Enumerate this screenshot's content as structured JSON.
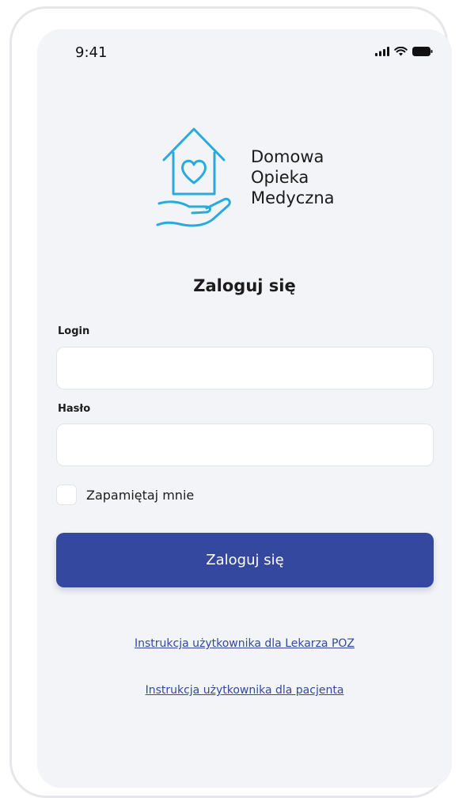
{
  "status_bar": {
    "time": "9:41",
    "icons": [
      "signal-icon",
      "wifi-icon",
      "battery-icon"
    ]
  },
  "logo": {
    "icon": "house-heart-hand-icon",
    "color": "#2aa9dc",
    "lines": [
      "Domowa",
      "Opieka",
      "Medyczna"
    ]
  },
  "form": {
    "title": "Zaloguj się",
    "login_label": "Login",
    "login_value": "",
    "password_label": "Hasło",
    "password_value": "",
    "remember_label": "Zapamiętaj mnie",
    "remember_checked": false,
    "submit_label": "Zaloguj się"
  },
  "links": {
    "doctor_manual": "Instrukcja użytkownika dla Lekarza POZ",
    "patient_manual": "Instrukcja użytkownika dla pacjenta"
  },
  "colors": {
    "accent": "#3448a0",
    "background": "#f3f4f8",
    "logo": "#2aa9dc"
  }
}
